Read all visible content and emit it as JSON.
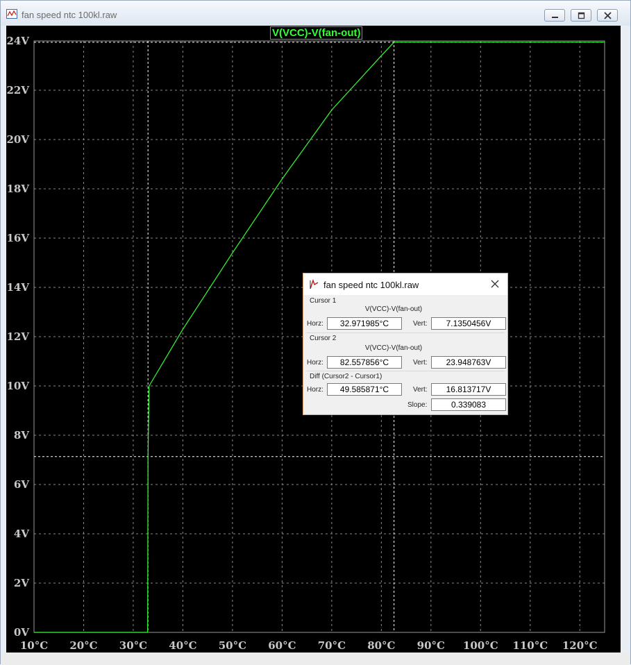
{
  "window": {
    "title": "fan speed ntc 100kl.raw"
  },
  "plot": {
    "trace_label": "V(VCC)-V(fan-out)",
    "background": "#000000",
    "trace_color": "#33ff33",
    "axis_text_color": "#c8c8c8"
  },
  "chart_data": {
    "type": "line",
    "title": "V(VCC)-V(fan-out)",
    "xlim": [
      10,
      125
    ],
    "ylim": [
      0,
      24
    ],
    "x_ticks": [
      "10°C",
      "20°C",
      "30°C",
      "40°C",
      "50°C",
      "60°C",
      "70°C",
      "80°C",
      "90°C",
      "100°C",
      "110°C",
      "120°C"
    ],
    "y_ticks": [
      "0V",
      "2V",
      "4V",
      "6V",
      "8V",
      "10V",
      "12V",
      "14V",
      "16V",
      "18V",
      "20V",
      "22V",
      "24V"
    ],
    "grid": true,
    "series": [
      {
        "name": "V(VCC)-V(fan-out)",
        "x": [
          10,
          32.9,
          32.97,
          33.2,
          40,
          50,
          60,
          70,
          80,
          82.56,
          125
        ],
        "y": [
          0,
          0,
          7.14,
          10.0,
          12.3,
          15.4,
          18.4,
          21.2,
          23.4,
          23.95,
          23.95
        ]
      }
    ],
    "cursors": [
      {
        "x": 32.971985,
        "y": 7.1350456
      },
      {
        "x": 82.557856,
        "y": 23.948763
      }
    ]
  },
  "cursor_dialog": {
    "title": "fan speed ntc 100kl.raw",
    "cursor1": {
      "label": "Cursor 1",
      "expr": "V(VCC)-V(fan-out)",
      "horz_label": "Horz:",
      "horz": "32.971985°C",
      "vert_label": "Vert:",
      "vert": "7.1350456V"
    },
    "cursor2": {
      "label": "Cursor 2",
      "expr": "V(VCC)-V(fan-out)",
      "horz_label": "Horz:",
      "horz": "82.557856°C",
      "vert_label": "Vert:",
      "vert": "23.948763V"
    },
    "diff": {
      "label": "Diff (Cursor2 - Cursor1)",
      "horz_label": "Horz:",
      "horz": "49.585871°C",
      "vert_label": "Vert:",
      "vert": "16.813717V",
      "slope_label": "Slope:",
      "slope": "0.339083"
    }
  }
}
